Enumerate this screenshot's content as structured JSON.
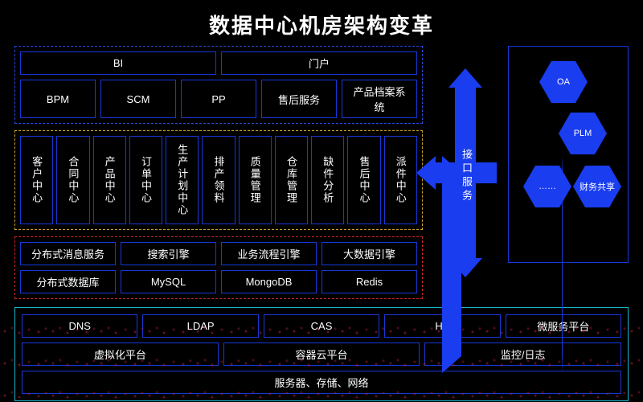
{
  "title": "数据中心机房架构变革",
  "top": {
    "row1": [
      "BI",
      "门户"
    ],
    "row2": [
      "BPM",
      "SCM",
      "PP",
      "售后服务",
      "产品档案系统"
    ]
  },
  "centers": [
    "客户中心",
    "合同中心",
    "产品中心",
    "订单中心",
    "生产计划中心",
    "排产领料",
    "质量管理",
    "仓库管理",
    "缺件分析",
    "售后中心",
    "派件中心"
  ],
  "engines": {
    "row1": [
      "分布式消息服务",
      "搜索引擎",
      "业务流程引擎",
      "大数据引擎"
    ],
    "row2": [
      "分布式数据库",
      "MySQL",
      "MongoDB",
      "Redis"
    ]
  },
  "mid_label": "接口服务",
  "right_hex": [
    "OA",
    "PLM",
    "……",
    "财务共享"
  ],
  "bottom": {
    "row1": [
      "DNS",
      "LDAP",
      "CAS",
      "HA",
      "微服务平台"
    ],
    "row2": [
      "虚拟化平台",
      "容器云平台",
      "监控/日志"
    ],
    "row3": [
      "服务器、存储、网络"
    ]
  }
}
